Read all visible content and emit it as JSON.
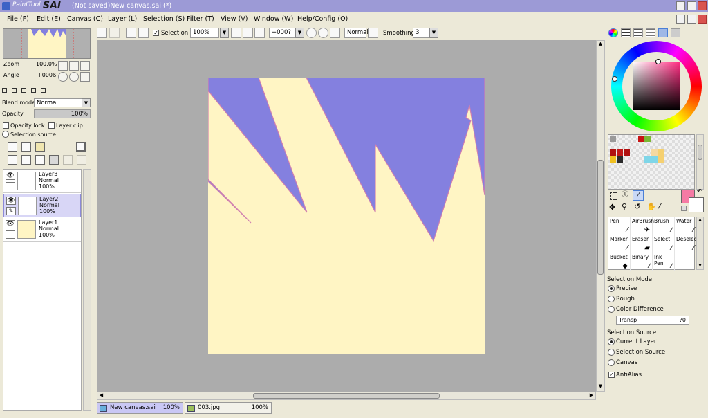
{
  "app": {
    "logo_small": "PaintTool",
    "logo_big": "SAI",
    "window_title": "(Not saved)New canvas.sai (*)"
  },
  "menu": [
    "File (F)",
    "Edit (E)",
    "Canvas (C)",
    "Layer (L)",
    "Selection (S)",
    "Filter (T)",
    "View (V)",
    "Window (W)",
    "Help/Config (O)"
  ],
  "navigator": {
    "zoom_label": "Zoom",
    "zoom_value": "100.0%",
    "angle_label": "Angle",
    "angle_value": "+000ß"
  },
  "layer_props": {
    "blend_mode_label": "Blend mode",
    "blend_mode_value": "Normal",
    "opacity_label": "Opacity",
    "opacity_value": "100%",
    "opacity_lock": "Opacity lock",
    "layer_clip": "Layer clip",
    "selection_source": "Selection source"
  },
  "layers": [
    {
      "name": "Layer3",
      "mode": "Normal",
      "opacity": "100%",
      "selected": false,
      "thumb_color": "#ffffff"
    },
    {
      "name": "Layer2",
      "mode": "Normal",
      "opacity": "100%",
      "selected": true,
      "thumb_color": "#ffffff"
    },
    {
      "name": "Layer1",
      "mode": "Normal",
      "opacity": "100%",
      "selected": false,
      "thumb_color": "#fff5c4"
    }
  ],
  "toolbar": {
    "selection_label": "Selection",
    "zoom_value": "100%",
    "angle_value": "+000?",
    "mode_value": "Normal",
    "smoothing_label": "Smoothing",
    "smoothing_value": "3"
  },
  "canvas": {
    "background_color": "#fff5c4",
    "spike_color": "#8480df",
    "outline_color": "#d080b0"
  },
  "tabs": [
    {
      "name": "New canvas.sai",
      "zoom": "100%",
      "active": true
    },
    {
      "name": "003.jpg",
      "zoom": "100%",
      "active": false
    }
  ],
  "colors": {
    "primary": "#f57aa4",
    "secondary": "#ffffff",
    "palette": [
      "#9a9a9a",
      "#c81414",
      "#7ab833",
      "#b01010",
      "#c01818",
      "#b01010",
      "#f5d9a0",
      "#f5d070",
      "#f0c020",
      "#2a2a2a",
      "#7fd6e8",
      "#f5d070"
    ]
  },
  "tools": [
    {
      "name": "Pen",
      "icon": "pen-icon"
    },
    {
      "name": "AirBrush",
      "icon": "airbrush-icon"
    },
    {
      "name": "Brush",
      "icon": "brush-icon"
    },
    {
      "name": "Water",
      "icon": "water-icon"
    },
    {
      "name": "Marker",
      "icon": "marker-icon"
    },
    {
      "name": "Eraser",
      "icon": "eraser-icon"
    },
    {
      "name": "Select",
      "icon": "select-icon"
    },
    {
      "name": "Deselect",
      "icon": "deselect-icon"
    },
    {
      "name": "Bucket",
      "icon": "bucket-icon"
    },
    {
      "name": "Binary",
      "icon": "binary-icon"
    },
    {
      "name": "Ink Pen",
      "icon": "ink-pen-icon"
    }
  ],
  "selection_panel": {
    "mode_title": "Selection Mode",
    "precise": "Precise",
    "rough": "Rough",
    "color_difference": "Color Difference",
    "transp_label": "Transp",
    "transp_value": "?0",
    "source_title": "Selection Source",
    "current_layer": "Current Layer",
    "selection_source": "Selection Source",
    "canvas": "Canvas",
    "antialias": "AntiAlias"
  }
}
